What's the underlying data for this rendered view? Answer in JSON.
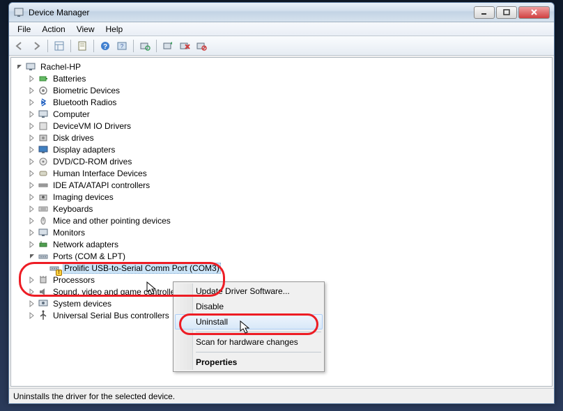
{
  "window": {
    "title": "Device Manager"
  },
  "menubar": [
    "File",
    "Action",
    "View",
    "Help"
  ],
  "statusbar": "Uninstalls the driver for the selected device.",
  "tree": {
    "root": "Rachel-HP",
    "categories": [
      {
        "label": "Batteries",
        "icon": "battery"
      },
      {
        "label": "Biometric Devices",
        "icon": "biometric"
      },
      {
        "label": "Bluetooth Radios",
        "icon": "bluetooth"
      },
      {
        "label": "Computer",
        "icon": "computer"
      },
      {
        "label": "DeviceVM IO Drivers",
        "icon": "device"
      },
      {
        "label": "Disk drives",
        "icon": "disk"
      },
      {
        "label": "Display adapters",
        "icon": "display"
      },
      {
        "label": "DVD/CD-ROM drives",
        "icon": "cdrom"
      },
      {
        "label": "Human Interface Devices",
        "icon": "hid"
      },
      {
        "label": "IDE ATA/ATAPI controllers",
        "icon": "ide"
      },
      {
        "label": "Imaging devices",
        "icon": "camera"
      },
      {
        "label": "Keyboards",
        "icon": "keyboard"
      },
      {
        "label": "Mice and other pointing devices",
        "icon": "mouse"
      },
      {
        "label": "Monitors",
        "icon": "monitor"
      },
      {
        "label": "Network adapters",
        "icon": "network"
      },
      {
        "label": "Ports (COM & LPT)",
        "icon": "port",
        "expanded": true,
        "children": [
          {
            "label": "Prolific USB-to-Serial Comm Port (COM3)",
            "icon": "port",
            "warn": true,
            "selected": true
          }
        ]
      },
      {
        "label": "Processors",
        "icon": "cpu"
      },
      {
        "label": "Sound, video and game controllers",
        "icon": "sound"
      },
      {
        "label": "System devices",
        "icon": "system"
      },
      {
        "label": "Universal Serial Bus controllers",
        "icon": "usb"
      }
    ]
  },
  "context_menu": {
    "items": [
      {
        "label": "Update Driver Software...",
        "type": "item"
      },
      {
        "label": "Disable",
        "type": "item"
      },
      {
        "label": "Uninstall",
        "type": "item",
        "hover": true
      },
      {
        "type": "sep"
      },
      {
        "label": "Scan for hardware changes",
        "type": "item"
      },
      {
        "type": "sep"
      },
      {
        "label": "Properties",
        "type": "item",
        "bold": true
      }
    ]
  },
  "toolbar_icons": [
    "back",
    "forward",
    "sep",
    "show-tree",
    "sep",
    "properties",
    "sep",
    "help",
    "help2",
    "sep",
    "scan",
    "sep",
    "update",
    "uninstall",
    "disable"
  ]
}
